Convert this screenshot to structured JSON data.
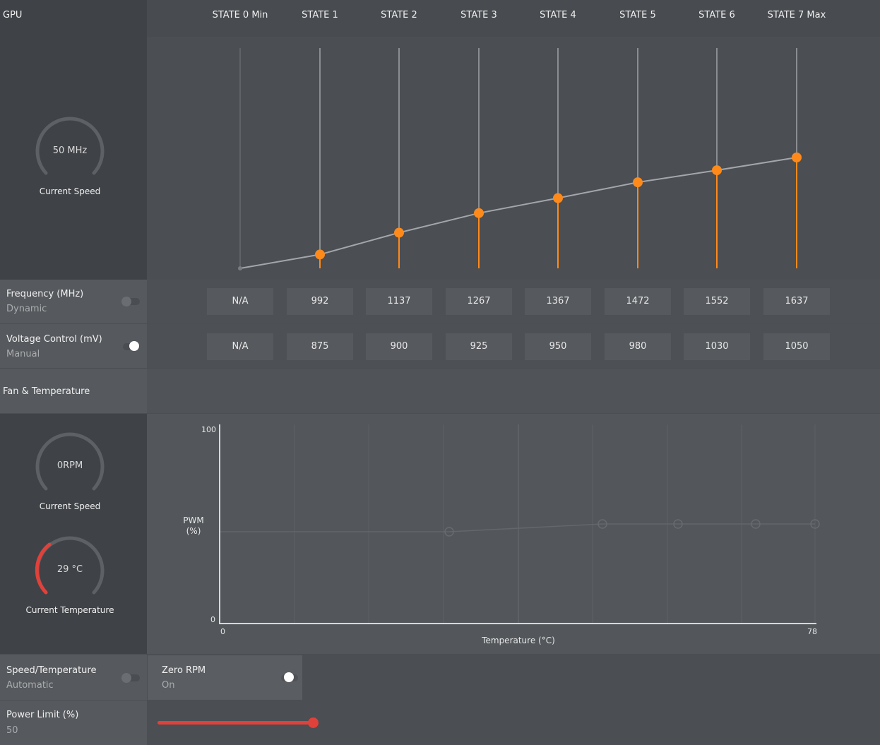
{
  "gpu": {
    "section_label": "GPU",
    "states": [
      "STATE 0 Min",
      "STATE 1",
      "STATE 2",
      "STATE 3",
      "STATE 4",
      "STATE 5",
      "STATE 6",
      "STATE 7 Max"
    ],
    "current_speed_value": "50 MHz",
    "current_speed_label": "Current Speed",
    "frequency": {
      "title": "Frequency (MHz)",
      "mode": "Dynamic",
      "values": [
        "N/A",
        "992",
        "1137",
        "1267",
        "1367",
        "1472",
        "1552",
        "1637"
      ]
    },
    "voltage": {
      "title": "Voltage Control (mV)",
      "mode": "Manual",
      "values": [
        "N/A",
        "875",
        "900",
        "925",
        "950",
        "980",
        "1030",
        "1050"
      ]
    },
    "accent_color": "#ff8a1a"
  },
  "fan": {
    "section_label": "Fan & Temperature",
    "speed_value": "0RPM",
    "speed_label": "Current Speed",
    "temp_value": "29 °C",
    "temp_label": "Current Temperature",
    "chart": {
      "ylabel": "PWM (%)",
      "xlabel": "Temperature (°C)",
      "y_min": "0",
      "y_max": "100",
      "x_min": "0",
      "x_max": "78"
    },
    "speed_temp": {
      "title": "Speed/Temperature",
      "mode": "Automatic"
    },
    "zero_rpm": {
      "title": "Zero RPM",
      "mode": "On"
    }
  },
  "power": {
    "title": "Power Limit (%)",
    "value": "50",
    "slider_fraction": 1.0,
    "slider_color": "#e0413a"
  }
}
